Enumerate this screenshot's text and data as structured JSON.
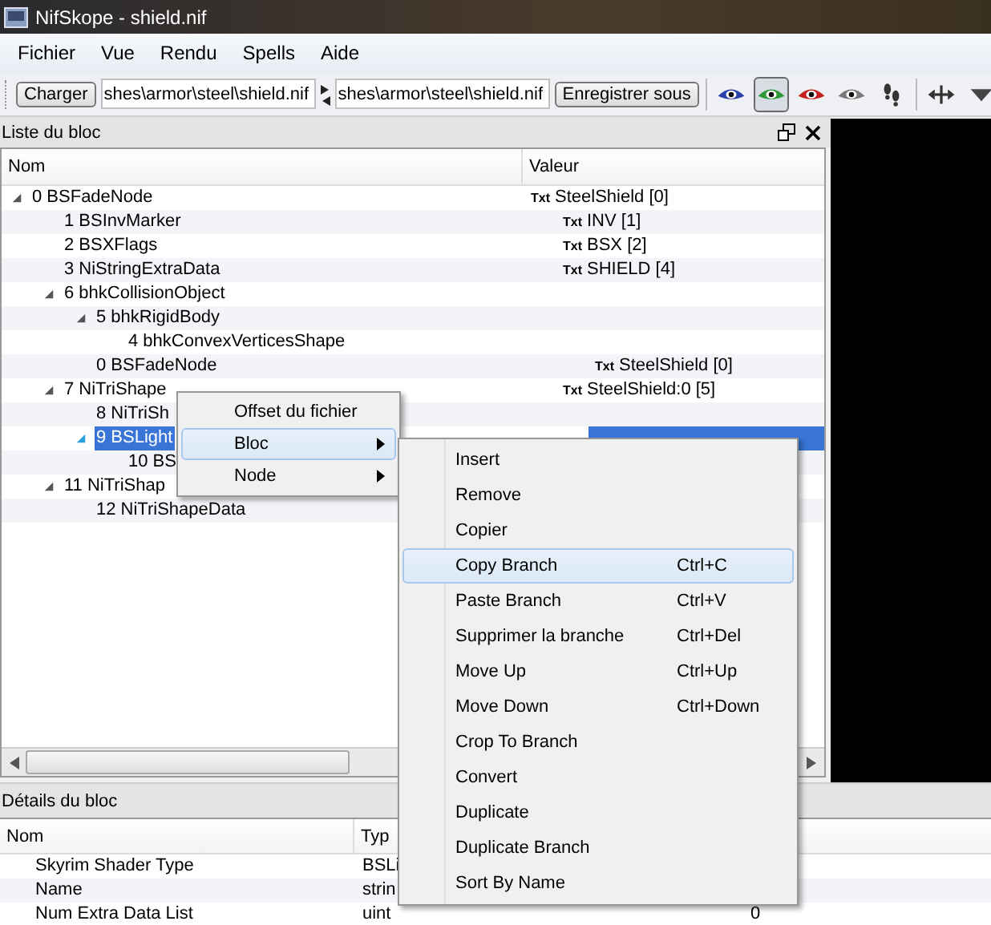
{
  "window": {
    "title": "NifSkope - shield.nif"
  },
  "menu_bar": [
    "Fichier",
    "Vue",
    "Rendu",
    "Spells",
    "Aide"
  ],
  "toolbar": {
    "load_button": "Charger",
    "load_path": "shes\\armor\\steel\\shield.nif",
    "save_path": "shes\\armor\\steel\\shield.nif",
    "save_button": "Enregistrer sous",
    "tools": [
      {
        "kind": "eye",
        "color": "#2b3fa8",
        "selected": false
      },
      {
        "kind": "eye",
        "color": "#2f9a3a",
        "selected": true
      },
      {
        "kind": "eye",
        "color": "#c42020",
        "selected": false
      },
      {
        "kind": "eye",
        "color": "#7a7a7a",
        "selected": false
      },
      {
        "kind": "footprints",
        "selected": false
      },
      {
        "kind": "move",
        "selected": false
      },
      {
        "kind": "triangle",
        "selected": false
      }
    ]
  },
  "block_list": {
    "title": "Liste du bloc",
    "columns": [
      "Nom",
      "Valeur"
    ],
    "tree": [
      {
        "name": "0 BSFadeNode",
        "tag": "Txt",
        "value": "SteelShield [0]",
        "expanded": true,
        "selected": false,
        "children": [
          {
            "name": "1 BSInvMarker",
            "tag": "Txt",
            "value": "INV [1]",
            "selected": false
          },
          {
            "name": "2 BSXFlags",
            "tag": "Txt",
            "value": "BSX [2]",
            "selected": false
          },
          {
            "name": "3 NiStringExtraData",
            "tag": "Txt",
            "value": "SHIELD [4]",
            "selected": false
          },
          {
            "name": "6 bhkCollisionObject",
            "expanded": true,
            "selected": false,
            "children": [
              {
                "name": "5 bhkRigidBody",
                "expanded": true,
                "selected": false,
                "children": [
                  {
                    "name": "4 bhkConvexVerticesShape",
                    "selected": false
                  }
                ]
              },
              {
                "name": "0 BSFadeNode",
                "tag": "Txt",
                "value": "SteelShield [0]",
                "selected": false
              }
            ]
          },
          {
            "name": "7 NiTriShape",
            "tag": "Txt",
            "value": "SteelShield:0 [5]",
            "expanded": true,
            "selected": false,
            "children": [
              {
                "name": "8 NiTriSh",
                "selected": false
              },
              {
                "name": "9 BSLight",
                "expanded": true,
                "selected": true,
                "children": [
                  {
                    "name": "10 BS",
                    "selected": false
                  }
                ]
              }
            ]
          },
          {
            "name": "11 NiTriShap",
            "expanded": true,
            "selected": false,
            "children": [
              {
                "name": "12 NiTriShapeData",
                "selected": false
              }
            ]
          }
        ]
      }
    ]
  },
  "block_details": {
    "title": "Détails du bloc",
    "columns": [
      "Nom",
      "Typ"
    ],
    "rows": [
      {
        "name": "Skyrim Shader Type",
        "type": "BSLi"
      },
      {
        "name": "Name",
        "type": "strin"
      },
      {
        "name": "Num Extra Data List",
        "type": "uint",
        "value": "0"
      }
    ]
  },
  "context_menu": {
    "items": [
      {
        "label": "Offset du fichier",
        "submenu": false,
        "selected": false
      },
      {
        "label": "Bloc",
        "submenu": true,
        "selected": true
      },
      {
        "label": "Node",
        "submenu": true,
        "selected": false
      }
    ]
  },
  "submenu": {
    "items": [
      {
        "label": "Insert",
        "selected": false
      },
      {
        "label": "Remove",
        "selected": false
      },
      {
        "label": "Copier",
        "selected": false
      },
      {
        "label": "Copy Branch",
        "shortcut": "Ctrl+C",
        "selected": true
      },
      {
        "label": "Paste Branch",
        "shortcut": "Ctrl+V",
        "selected": false
      },
      {
        "label": "Supprimer la branche",
        "shortcut": "Ctrl+Del",
        "selected": false
      },
      {
        "label": "Move Up",
        "shortcut": "Ctrl+Up",
        "selected": false
      },
      {
        "label": "Move Down",
        "shortcut": "Ctrl+Down",
        "selected": false
      },
      {
        "label": "Crop To Branch",
        "selected": false
      },
      {
        "label": "Convert",
        "selected": false
      },
      {
        "label": "Duplicate",
        "selected": false
      },
      {
        "label": "Duplicate Branch",
        "selected": false
      },
      {
        "label": "Sort By Name",
        "selected": false
      }
    ]
  }
}
